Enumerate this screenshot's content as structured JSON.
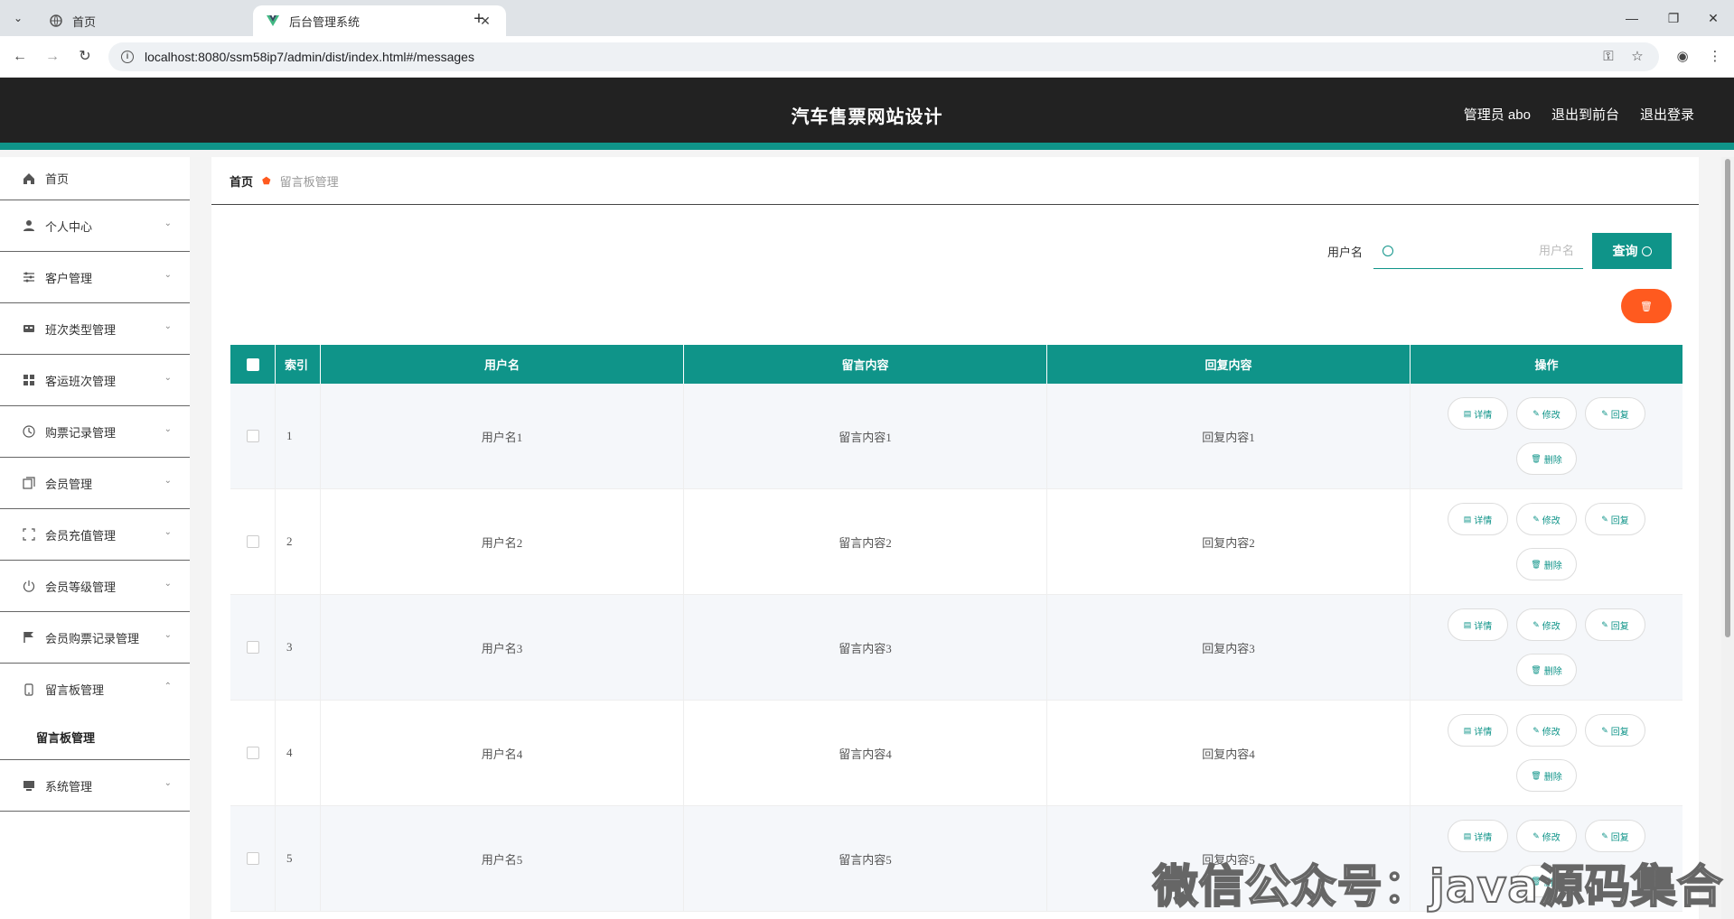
{
  "browser": {
    "tabs": [
      {
        "title": "首页",
        "active": false
      },
      {
        "title": "后台管理系统",
        "active": true
      }
    ],
    "url": "localhost:8080/ssm58ip7/admin/dist/index.html#/messages"
  },
  "header": {
    "title": "汽车售票网站设计",
    "user": "管理员 abo",
    "to_front": "退出到前台",
    "logout": "退出登录"
  },
  "sidebar": {
    "items": [
      {
        "label": "首页",
        "icon": "home-icon"
      },
      {
        "label": "个人中心",
        "icon": "user-icon"
      },
      {
        "label": "客户管理",
        "icon": "sliders-icon"
      },
      {
        "label": "班次类型管理",
        "icon": "bus-icon"
      },
      {
        "label": "客运班次管理",
        "icon": "grid-icon"
      },
      {
        "label": "购票记录管理",
        "icon": "clock-icon"
      },
      {
        "label": "会员管理",
        "icon": "copy-icon"
      },
      {
        "label": "会员充值管理",
        "icon": "frame-icon"
      },
      {
        "label": "会员等级管理",
        "icon": "power-icon"
      },
      {
        "label": "会员购票记录管理",
        "icon": "flag-icon"
      },
      {
        "label": "留言板管理",
        "icon": "phone-icon"
      },
      {
        "label": "系统管理",
        "icon": "monitor-icon"
      }
    ],
    "submenu_label": "留言板管理"
  },
  "breadcrumb": {
    "home": "首页",
    "current": "留言板管理"
  },
  "search": {
    "label": "用户名",
    "placeholder": "用户名",
    "button": "查询"
  },
  "table": {
    "headers": {
      "index": "索引",
      "username": "用户名",
      "content": "留言内容",
      "reply": "回复内容",
      "ops": "操作"
    },
    "rows": [
      {
        "index": "1",
        "username": "用户名1",
        "content": "留言内容1",
        "reply": "回复内容1"
      },
      {
        "index": "2",
        "username": "用户名2",
        "content": "留言内容2",
        "reply": "回复内容2"
      },
      {
        "index": "3",
        "username": "用户名3",
        "content": "留言内容3",
        "reply": "回复内容3"
      },
      {
        "index": "4",
        "username": "用户名4",
        "content": "留言内容4",
        "reply": "回复内容4"
      },
      {
        "index": "5",
        "username": "用户名5",
        "content": "留言内容5",
        "reply": "回复内容5"
      }
    ],
    "ops": {
      "detail": "详情",
      "edit": "修改",
      "reply": "回复",
      "delete": "删除"
    }
  },
  "watermark": "微信公众号：java源码集合",
  "colors": {
    "accent": "#0f9489",
    "header_bg": "#222222",
    "danger": "#ff5a1f"
  }
}
